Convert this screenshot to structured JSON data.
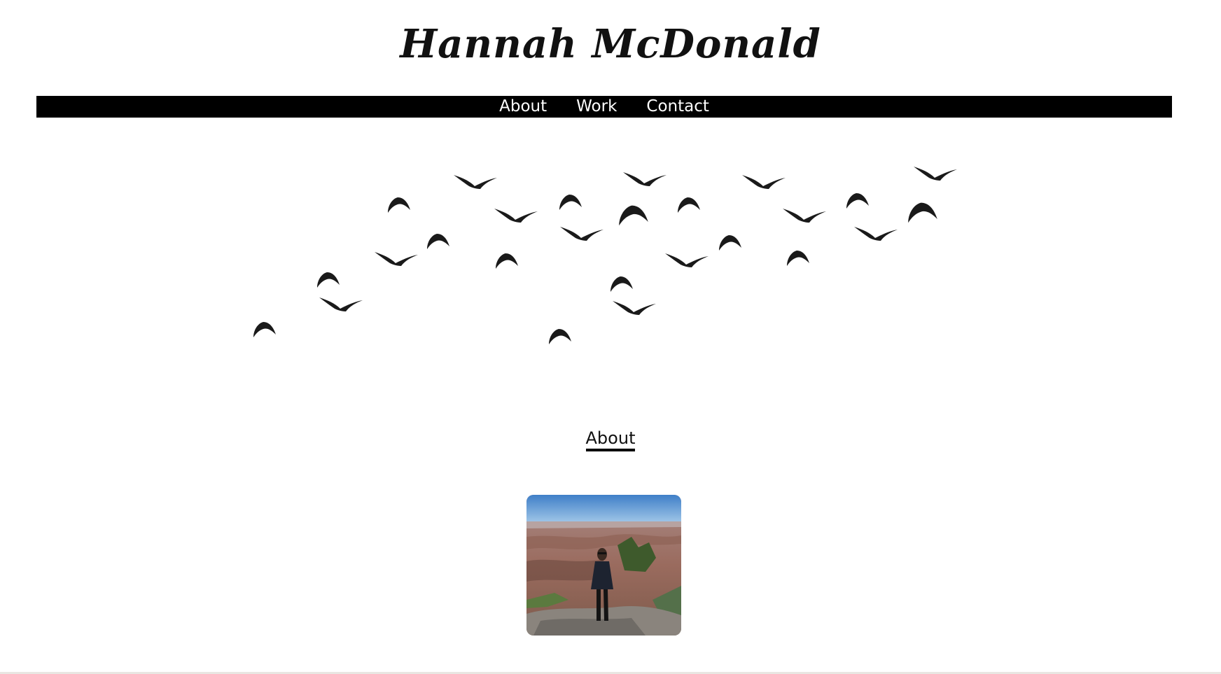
{
  "header": {
    "site_title": "Hannah McDonald"
  },
  "nav": {
    "items": [
      {
        "label": "About"
      },
      {
        "label": "Work"
      },
      {
        "label": "Contact"
      }
    ]
  },
  "hero": {
    "illustration": "flock-of-birds"
  },
  "about": {
    "heading": "About",
    "photo": "profile-photo-grand-canyon"
  },
  "colors": {
    "nav_background": "#000000",
    "nav_text": "#ffffff",
    "title_text": "#111111",
    "bird_fill": "#1a1a1a"
  }
}
